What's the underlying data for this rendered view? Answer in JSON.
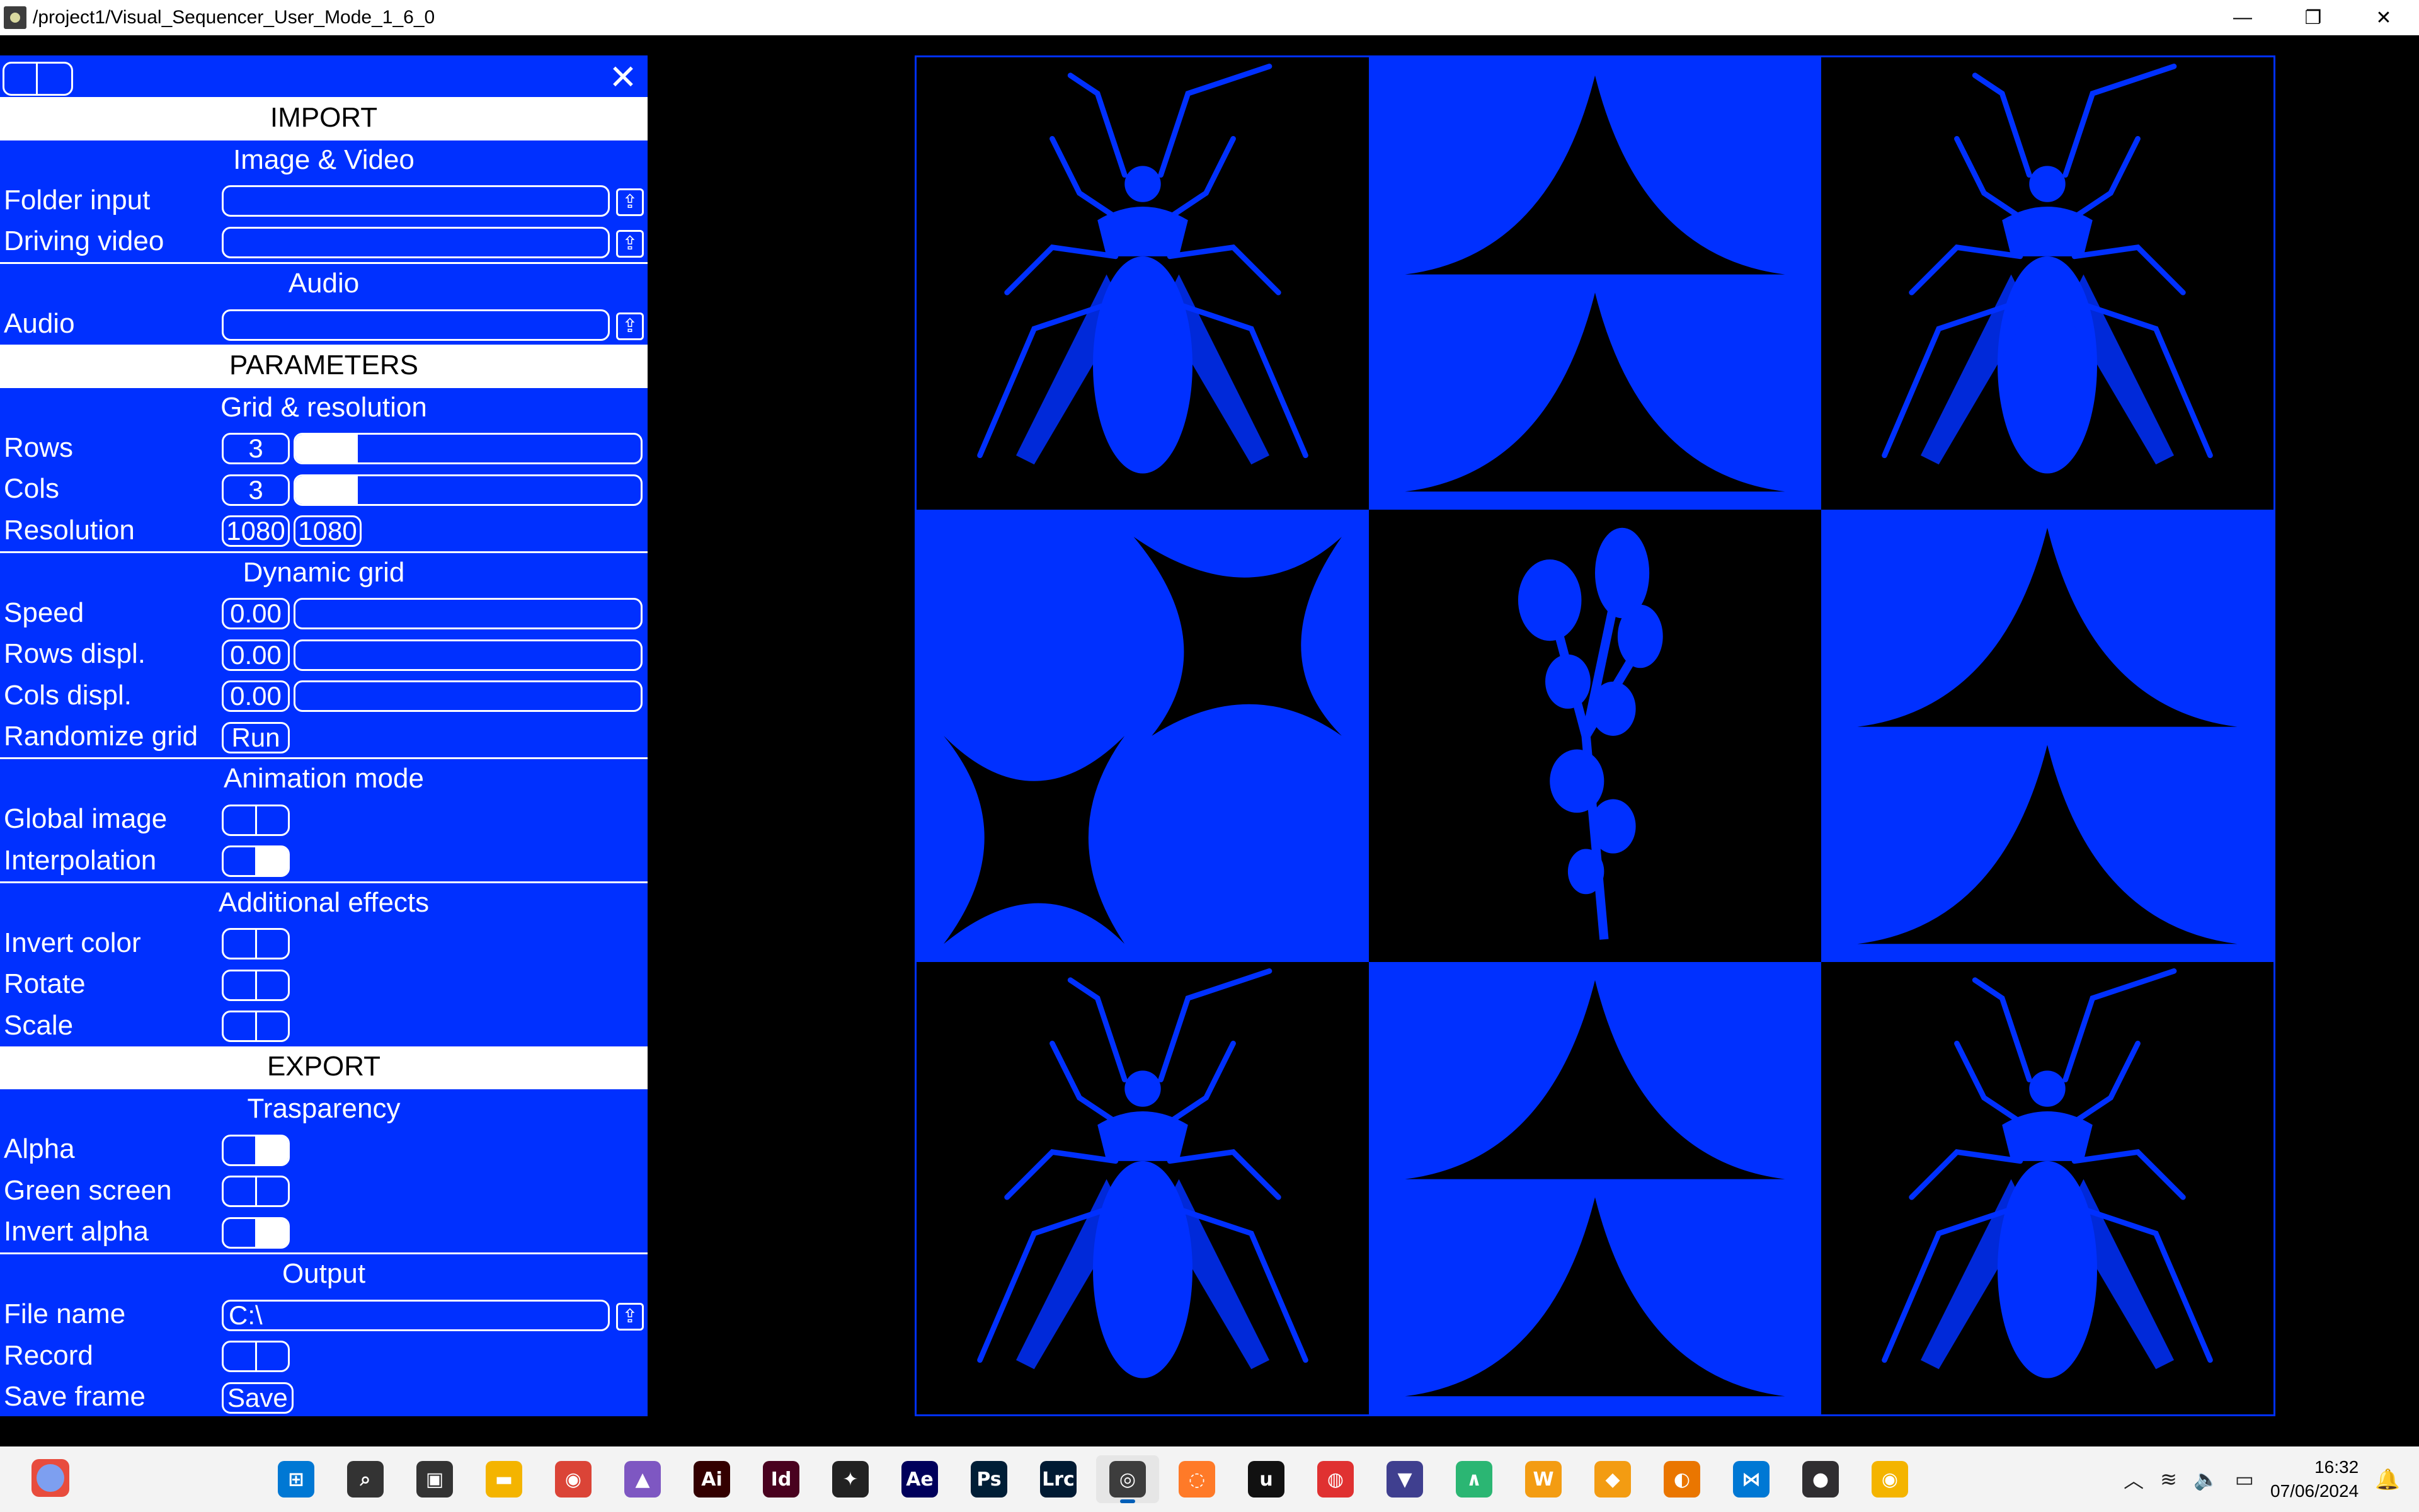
{
  "window": {
    "title": "/project1/Visual_Sequencer_User_Mode_1_6_0",
    "minimize": "—",
    "maximize": "❐",
    "close": "✕"
  },
  "panel": {
    "close": "✕",
    "import": {
      "title": "IMPORT",
      "image_video": "Image & Video",
      "folder_input": "Folder input",
      "folder_input_value": "",
      "driving_video": "Driving video",
      "driving_video_value": "",
      "audio_header": "Audio",
      "audio": "Audio",
      "audio_value": ""
    },
    "parameters": {
      "title": "PARAMETERS",
      "grid_resolution": "Grid & resolution",
      "rows_label": "Rows",
      "rows_value": "3",
      "rows_fraction": 0.18,
      "cols_label": "Cols",
      "cols_value": "3",
      "cols_fraction": 0.18,
      "resolution_label": "Resolution",
      "resolution_w": "1080",
      "resolution_h": "1080",
      "dynamic_grid": "Dynamic grid",
      "speed_label": "Speed",
      "speed_value": "0.00",
      "rows_displ_label": "Rows displ.",
      "rows_displ_value": "0.00",
      "cols_displ_label": "Cols displ.",
      "cols_displ_value": "0.00",
      "randomize_label": "Randomize grid",
      "randomize_button": "Run",
      "animation_mode": "Animation mode",
      "global_image_label": "Global image",
      "interpolation_label": "Interpolation",
      "additional_effects": "Additional effects",
      "invert_color_label": "Invert color",
      "rotate_label": "Rotate",
      "scale_label": "Scale"
    },
    "export": {
      "title": "EXPORT",
      "trasparency": "Trasparency",
      "alpha_label": "Alpha",
      "green_screen_label": "Green screen",
      "invert_alpha_label": "Invert alpha",
      "output": "Output",
      "file_name_label": "File name",
      "file_name_value": "C:\\",
      "record_label": "Record",
      "save_frame_label": "Save frame",
      "save_button": "Save"
    }
  },
  "toggles": {
    "global_image": false,
    "interpolation": true,
    "invert_color": false,
    "rotate": false,
    "scale": false,
    "alpha": true,
    "green_screen": false,
    "invert_alpha": true,
    "record": false
  },
  "taskbar": {
    "apps": [
      {
        "name": "windows-start",
        "glyph": "⊞",
        "color": "#0078d4"
      },
      {
        "name": "search",
        "glyph": "⌕",
        "color": "#333333"
      },
      {
        "name": "task-view",
        "glyph": "▣",
        "color": "#333333"
      },
      {
        "name": "file-explorer",
        "glyph": "▬",
        "color": "#f4b400"
      },
      {
        "name": "chrome",
        "glyph": "◉",
        "color": "#db4437"
      },
      {
        "name": "affinity",
        "glyph": "▲",
        "color": "#7e57c2"
      },
      {
        "name": "illustrator",
        "glyph": "Ai",
        "color": "#330000"
      },
      {
        "name": "indesign",
        "glyph": "Id",
        "color": "#49021f"
      },
      {
        "name": "figma",
        "glyph": "✦",
        "color": "#222222"
      },
      {
        "name": "after-effects",
        "glyph": "Ae",
        "color": "#00005b"
      },
      {
        "name": "photoshop",
        "glyph": "Ps",
        "color": "#001e36"
      },
      {
        "name": "lightroom-classic",
        "glyph": "Lrc",
        "color": "#001a33"
      },
      {
        "name": "touchdesigner",
        "glyph": "◎",
        "color": "#3d3d3d"
      },
      {
        "name": "houdini",
        "glyph": "◌",
        "color": "#ff7a28"
      },
      {
        "name": "unreal-engine",
        "glyph": "u",
        "color": "#111111"
      },
      {
        "name": "substance",
        "glyph": "◍",
        "color": "#e03131"
      },
      {
        "name": "app-purple",
        "glyph": "▼",
        "color": "#3f3f8f"
      },
      {
        "name": "app-green",
        "glyph": "∧",
        "color": "#2bb673"
      },
      {
        "name": "app-orange",
        "glyph": "W",
        "color": "#f39c12"
      },
      {
        "name": "app-box",
        "glyph": "◆",
        "color": "#f39c12"
      },
      {
        "name": "blender",
        "glyph": "◐",
        "color": "#ea7600"
      },
      {
        "name": "vscode",
        "glyph": "⋈",
        "color": "#0078d4"
      },
      {
        "name": "obs",
        "glyph": "●",
        "color": "#302e31"
      },
      {
        "name": "chrome-canary",
        "glyph": "◉",
        "color": "#f4b400"
      }
    ],
    "active_index": 12,
    "time": "16:32",
    "date": "07/06/2024",
    "tray_chevron": "︿",
    "wifi": "≋",
    "volume": "🔈",
    "battery": "▭",
    "notification": "🔔"
  },
  "colors": {
    "accent": "#0030ff",
    "background": "#000000"
  },
  "preview": {
    "cells": [
      "bug",
      "arches-up",
      "bug",
      "star-corners",
      "plant",
      "arches-up",
      "bug",
      "arches-up",
      "bug"
    ]
  }
}
